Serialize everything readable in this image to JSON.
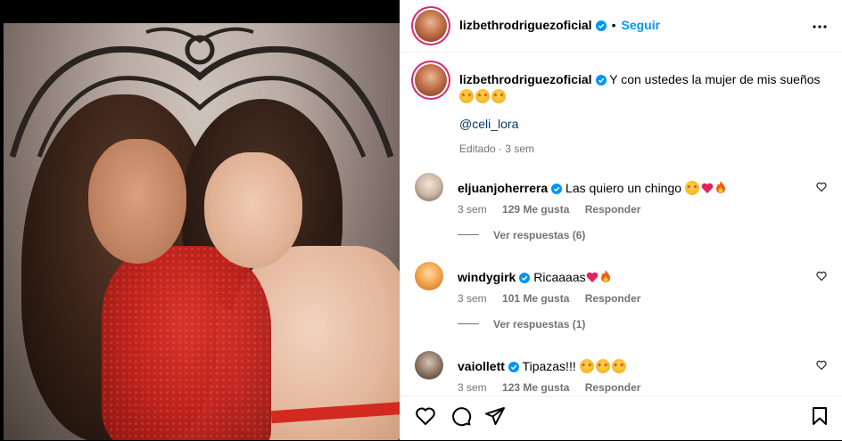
{
  "post": {
    "username": "lizbethrodriguezoficial",
    "follow_label": "Seguir",
    "separator": "•",
    "caption_text": "Y con ustedes la mujer de mis sueños",
    "caption_mention": "@celi_lora",
    "caption_meta": "Editado · 3 sem"
  },
  "comments": [
    {
      "username": "eljuanjoherrera",
      "text": "Las quiero un chingo",
      "time": "3 sem",
      "likes": "129 Me gusta",
      "reply_label": "Responder",
      "view_replies": "Ver respuestas (6)"
    },
    {
      "username": "windygirk",
      "text": "Ricaaaas",
      "time": "3 sem",
      "likes": "101 Me gusta",
      "reply_label": "Responder",
      "view_replies": "Ver respuestas (1)"
    },
    {
      "username": "vaiollett",
      "text": "Tipazas!!!",
      "time": "3 sem",
      "likes": "123 Me gusta",
      "reply_label": "Responder"
    }
  ],
  "icons": {
    "more": "more-horizontal-icon",
    "like": "heart-outline-icon",
    "comment": "comment-bubble-icon",
    "share": "paper-plane-icon",
    "save": "bookmark-icon",
    "verified": "verified-badge-icon"
  },
  "colors": {
    "accent": "#0095f6",
    "verified": "#0095f6",
    "secondary_text": "#737373",
    "mention": "#00376b"
  }
}
